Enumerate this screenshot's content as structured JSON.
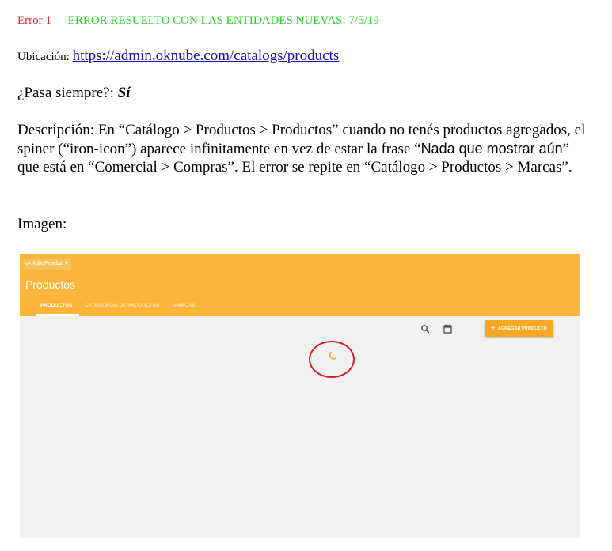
{
  "error": {
    "label": "Error 1",
    "note": "-ERROR RESUELTO CON LAS ENTIDADES NUEVAS: 7/5/19-"
  },
  "ubicacion": {
    "label": "Ubicación:",
    "url": "https://admin.oknube.com/catalogs/products"
  },
  "pasa": {
    "label": "¿Pasa siempre?:",
    "value": "Sí"
  },
  "descripcion": {
    "part1": "Descripción: En “Catálogo >  Productos > Productos” cuando no tenés productos agregados, el spiner (“iron-icon”) aparece infinitamente en vez de estar la frase “",
    "part2": "Nada que mostrar aún",
    "part3": "” que está en “Comercial > Compras”. El error se repite en “Catálogo >  Productos > Marcas”."
  },
  "imagen": {
    "label": "Imagen:"
  },
  "screenshot": {
    "org_selector": "okNubePrueba",
    "page_title": "Productos",
    "tabs": [
      "PRODUCTOS",
      "CATEGORÍAS DE PRODUCTOS",
      "MARCAS"
    ],
    "active_tab": "PRODUCTOS",
    "add_button": "AGREGAR PRODUCTO",
    "icons": [
      "search-icon",
      "calendar-icon",
      "plus-icon",
      "spinner-icon",
      "chevron-down-icon"
    ],
    "colors": {
      "header": "#fbb53a",
      "button": "#f9a825",
      "highlight": "#d41c24",
      "body": "#f1f1f1"
    }
  }
}
